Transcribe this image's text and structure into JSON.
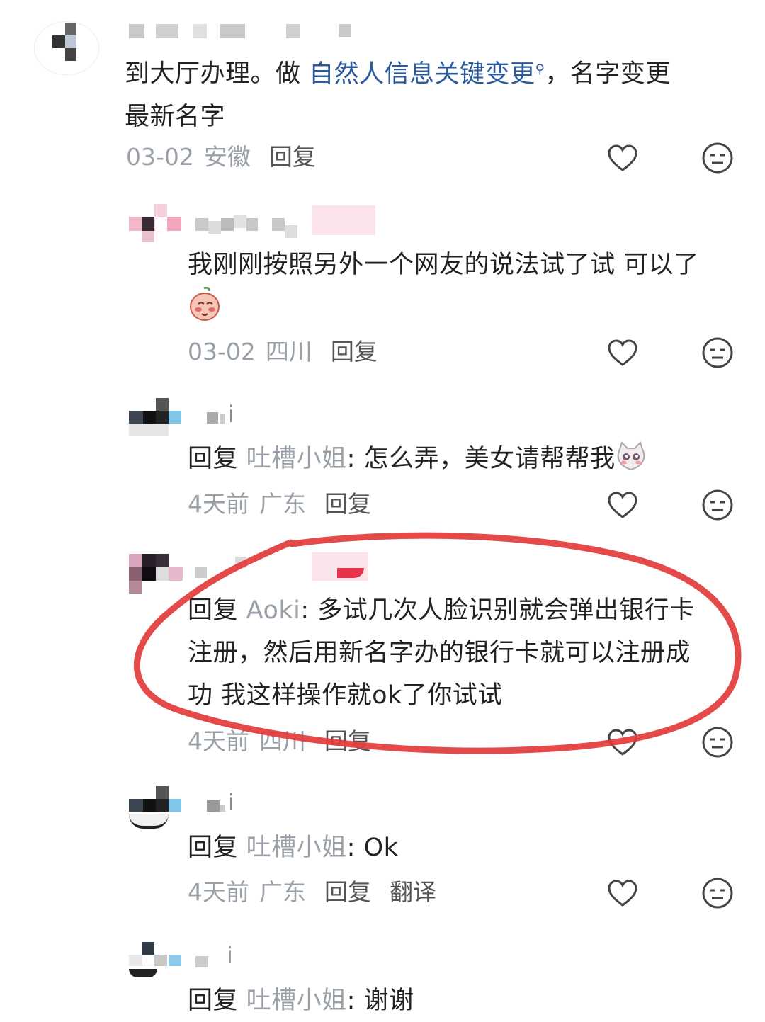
{
  "comments": [
    {
      "text_parts": [
        "到大厅办理。做 ",
        "自然人信息关键变更",
        "，名字变更",
        "最新名字"
      ],
      "link_sup": "Q",
      "date": "03-02",
      "location": "安徽",
      "reply_label": "回复"
    },
    {
      "text": "我刚刚按照另外一个网友的说法试了试 可以了",
      "date": "03-02",
      "location": "四川",
      "reply_label": "回复"
    },
    {
      "reply_prefix": "回复",
      "reply_to": "吐槽小姐",
      "name_fragment": "i",
      "text": ": 怎么弄，美女请帮帮我",
      "date": "4天前",
      "location": "广东",
      "reply_label": "回复"
    },
    {
      "reply_prefix": "回复",
      "reply_to": "Aoki",
      "text_line1": ": 多试几次人脸识别就会弹出银行卡",
      "text_line2": "注册，然后用新名字办的银行卡就可以注册成",
      "text_line3": "功 我这样操作就ok了你试试",
      "date": "4天前",
      "location": "四川",
      "reply_label": "回复"
    },
    {
      "reply_prefix": "回复",
      "reply_to": "吐槽小姐",
      "name_fragment": "i",
      "text": ": Ok",
      "date": "4天前",
      "location": "广东",
      "reply_label": "回复",
      "translate_label": "翻译"
    },
    {
      "reply_prefix": "回复",
      "reply_to": "吐槽小姐",
      "name_fragment": "i",
      "text": ": 谢谢"
    }
  ],
  "colors": {
    "text": "#222222",
    "meta": "#9aa0a8",
    "link": "#2b5a9c",
    "highlight_ellipse": "#e23b3b"
  },
  "icons": {
    "like": "heart-outline-icon",
    "dislike": "neutral-face-icon",
    "search_sup": "search-icon"
  }
}
